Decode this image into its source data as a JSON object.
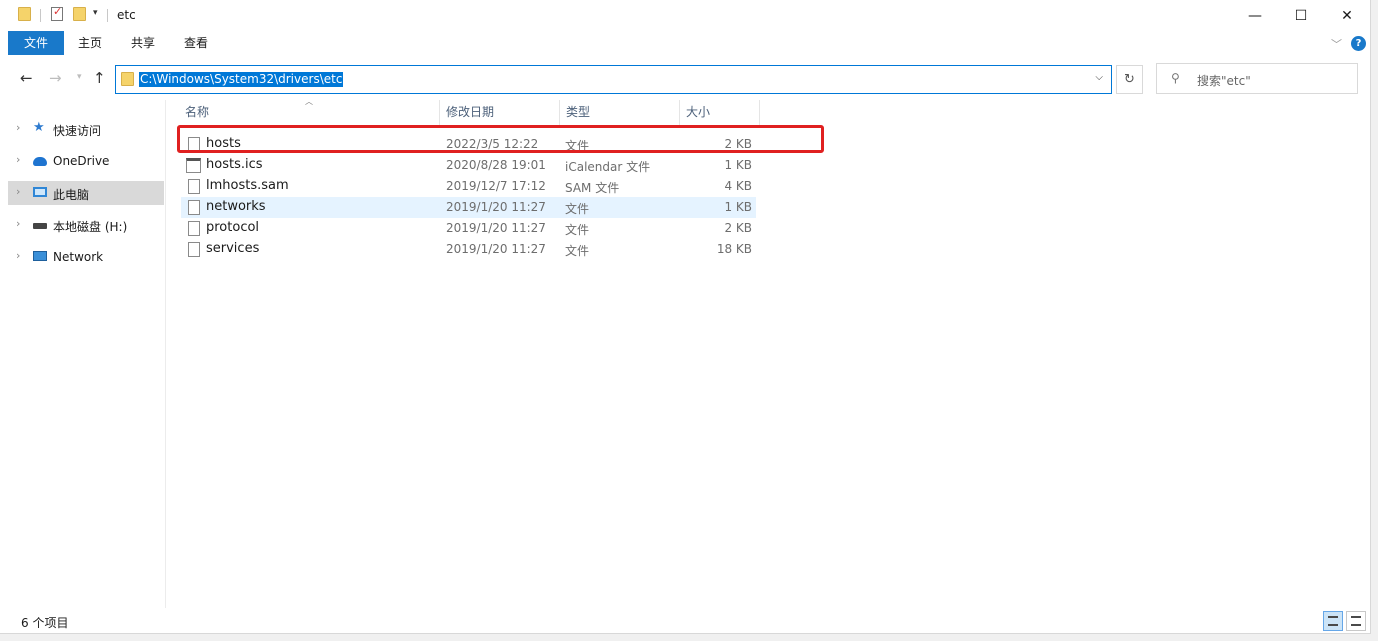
{
  "window": {
    "title": "etc"
  },
  "ribbon": {
    "tabs": [
      "文件",
      "主页",
      "共享",
      "查看"
    ]
  },
  "address": {
    "path": "C:\\Windows\\System32\\drivers\\etc"
  },
  "search": {
    "placeholder": "搜索\"etc\""
  },
  "nav_pane": {
    "items": [
      {
        "label": "快速访问",
        "icon": "star-icon"
      },
      {
        "label": "OneDrive",
        "icon": "cloud-icon"
      },
      {
        "label": "此电脑",
        "icon": "computer-icon",
        "selected": true
      },
      {
        "label": "本地磁盘 (H:)",
        "icon": "drive-icon"
      },
      {
        "label": "Network",
        "icon": "network-icon"
      }
    ]
  },
  "columns": {
    "name": "名称",
    "date": "修改日期",
    "type": "类型",
    "size": "大小"
  },
  "files": [
    {
      "name": "hosts",
      "date": "2022/3/5 12:22",
      "type": "文件",
      "size": "2 KB",
      "icon": "file-icon"
    },
    {
      "name": "hosts.ics",
      "date": "2020/8/28 19:01",
      "type": "iCalendar 文件",
      "size": "1 KB",
      "icon": "calendar-file-icon"
    },
    {
      "name": "lmhosts.sam",
      "date": "2019/12/7 17:12",
      "type": "SAM 文件",
      "size": "4 KB",
      "icon": "file-icon"
    },
    {
      "name": "networks",
      "date": "2019/1/20 11:27",
      "type": "文件",
      "size": "1 KB",
      "icon": "file-icon",
      "hovered": true
    },
    {
      "name": "protocol",
      "date": "2019/1/20 11:27",
      "type": "文件",
      "size": "2 KB",
      "icon": "file-icon"
    },
    {
      "name": "services",
      "date": "2019/1/20 11:27",
      "type": "文件",
      "size": "18 KB",
      "icon": "file-icon"
    }
  ],
  "status": {
    "item_count": "6 个项目"
  },
  "colors": {
    "accent": "#0078d7",
    "ribbon_file": "#1979ca",
    "annotation": "#e02020",
    "hover": "#e5f3ff"
  }
}
